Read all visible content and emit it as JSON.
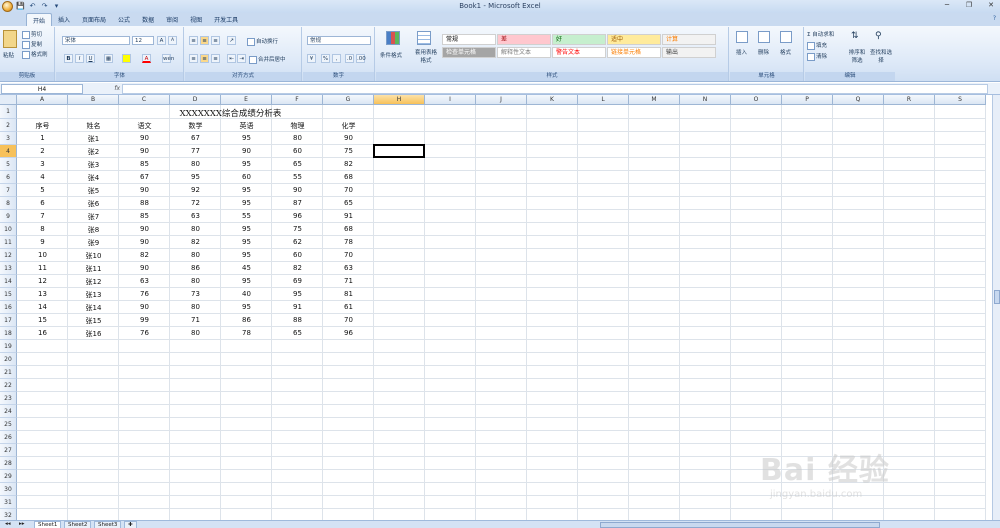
{
  "window": {
    "title": "Book1 - Microsoft Excel"
  },
  "qat": {
    "save": "💾",
    "undo": "↶",
    "redo": "↷",
    "more": "▾"
  },
  "tabs": [
    "开始",
    "插入",
    "页面布局",
    "公式",
    "数据",
    "审阅",
    "视图",
    "开发工具"
  ],
  "ribbon": {
    "clipboard": {
      "label": "剪贴板",
      "paste": "粘贴",
      "cut": "剪切",
      "copy": "复制",
      "format_painter": "格式刷"
    },
    "font": {
      "label": "字体",
      "font_name": "宋体",
      "font_size": "12",
      "bold": "B",
      "italic": "I",
      "underline": "U",
      "grow": "A",
      "shrink": "A",
      "wen": "wén"
    },
    "alignment": {
      "label": "对齐方式",
      "wrap": "自动换行",
      "merge": "合并后居中"
    },
    "number": {
      "label": "数字",
      "format": "常规",
      "percent": "%",
      "comma": ","
    },
    "styles": {
      "label": "样式",
      "conditional": "条件格式",
      "table": "套用表格格式",
      "cells": [
        {
          "text": "常规",
          "bg": "#ffffff",
          "color": "#000000"
        },
        {
          "text": "差",
          "bg": "#ffc7ce",
          "color": "#9c0006"
        },
        {
          "text": "好",
          "bg": "#c6efce",
          "color": "#006100"
        },
        {
          "text": "适中",
          "bg": "#ffeb9c",
          "color": "#9c5700"
        },
        {
          "text": "计算",
          "bg": "#f2f2f2",
          "color": "#fa7d00"
        },
        {
          "text": "检查单元格",
          "bg": "#a5a5a5",
          "color": "#ffffff"
        },
        {
          "text": "解释性文本",
          "bg": "#ffffff",
          "color": "#7f7f7f"
        },
        {
          "text": "警告文本",
          "bg": "#ffffff",
          "color": "#ff0000"
        },
        {
          "text": "链接单元格",
          "bg": "#ffffff",
          "color": "#fa7d00"
        },
        {
          "text": "输出",
          "bg": "#f2f2f2",
          "color": "#3f3f3f"
        }
      ]
    },
    "cells_group": {
      "label": "单元格",
      "insert": "插入",
      "delete": "删除",
      "format": "格式"
    },
    "editing": {
      "label": "编辑",
      "autosum": "自动求和",
      "fill": "填充",
      "clear": "清除",
      "sort": "排序和筛选",
      "find": "查找和选择"
    }
  },
  "formula_bar": {
    "name_box": "H4",
    "fx": "fx",
    "content": ""
  },
  "columns": [
    "A",
    "B",
    "C",
    "D",
    "E",
    "F",
    "G",
    "H",
    "I",
    "J",
    "K",
    "L",
    "M",
    "N",
    "O",
    "P",
    "Q",
    "R",
    "S"
  ],
  "rows": [
    "1",
    "2",
    "3",
    "4",
    "5",
    "6",
    "7",
    "8",
    "9",
    "10",
    "11",
    "12",
    "13",
    "14",
    "15",
    "16",
    "17",
    "18",
    "19",
    "20",
    "21",
    "22",
    "23",
    "24",
    "25",
    "26",
    "27",
    "28",
    "29",
    "30",
    "31",
    "32"
  ],
  "sheet": {
    "title": "XXXXXXX综合成绩分析表",
    "headers": [
      "序号",
      "姓名",
      "语文",
      "数学",
      "英语",
      "物理",
      "化学"
    ],
    "data": [
      [
        "1",
        "张1",
        "90",
        "67",
        "95",
        "80",
        "90"
      ],
      [
        "2",
        "张2",
        "90",
        "77",
        "90",
        "60",
        "75"
      ],
      [
        "3",
        "张3",
        "85",
        "80",
        "95",
        "65",
        "82"
      ],
      [
        "4",
        "张4",
        "67",
        "95",
        "60",
        "55",
        "68"
      ],
      [
        "5",
        "张5",
        "90",
        "92",
        "95",
        "90",
        "70"
      ],
      [
        "6",
        "张6",
        "88",
        "72",
        "95",
        "87",
        "65"
      ],
      [
        "7",
        "张7",
        "85",
        "63",
        "55",
        "96",
        "91"
      ],
      [
        "8",
        "张8",
        "90",
        "80",
        "95",
        "75",
        "68"
      ],
      [
        "9",
        "张9",
        "90",
        "82",
        "95",
        "62",
        "78"
      ],
      [
        "10",
        "张10",
        "82",
        "80",
        "95",
        "60",
        "70"
      ],
      [
        "11",
        "张11",
        "90",
        "86",
        "45",
        "82",
        "63"
      ],
      [
        "12",
        "张12",
        "63",
        "80",
        "95",
        "69",
        "71"
      ],
      [
        "13",
        "张13",
        "76",
        "73",
        "40",
        "95",
        "81"
      ],
      [
        "14",
        "张14",
        "90",
        "80",
        "95",
        "91",
        "61"
      ],
      [
        "15",
        "张15",
        "99",
        "71",
        "86",
        "88",
        "70"
      ],
      [
        "16",
        "张16",
        "76",
        "80",
        "78",
        "65",
        "96"
      ]
    ]
  },
  "sheet_tabs": [
    "Sheet1",
    "Sheet2",
    "Sheet3"
  ],
  "watermark": {
    "brand": "Bai 经验",
    "url": "jingyan.baidu.com"
  }
}
